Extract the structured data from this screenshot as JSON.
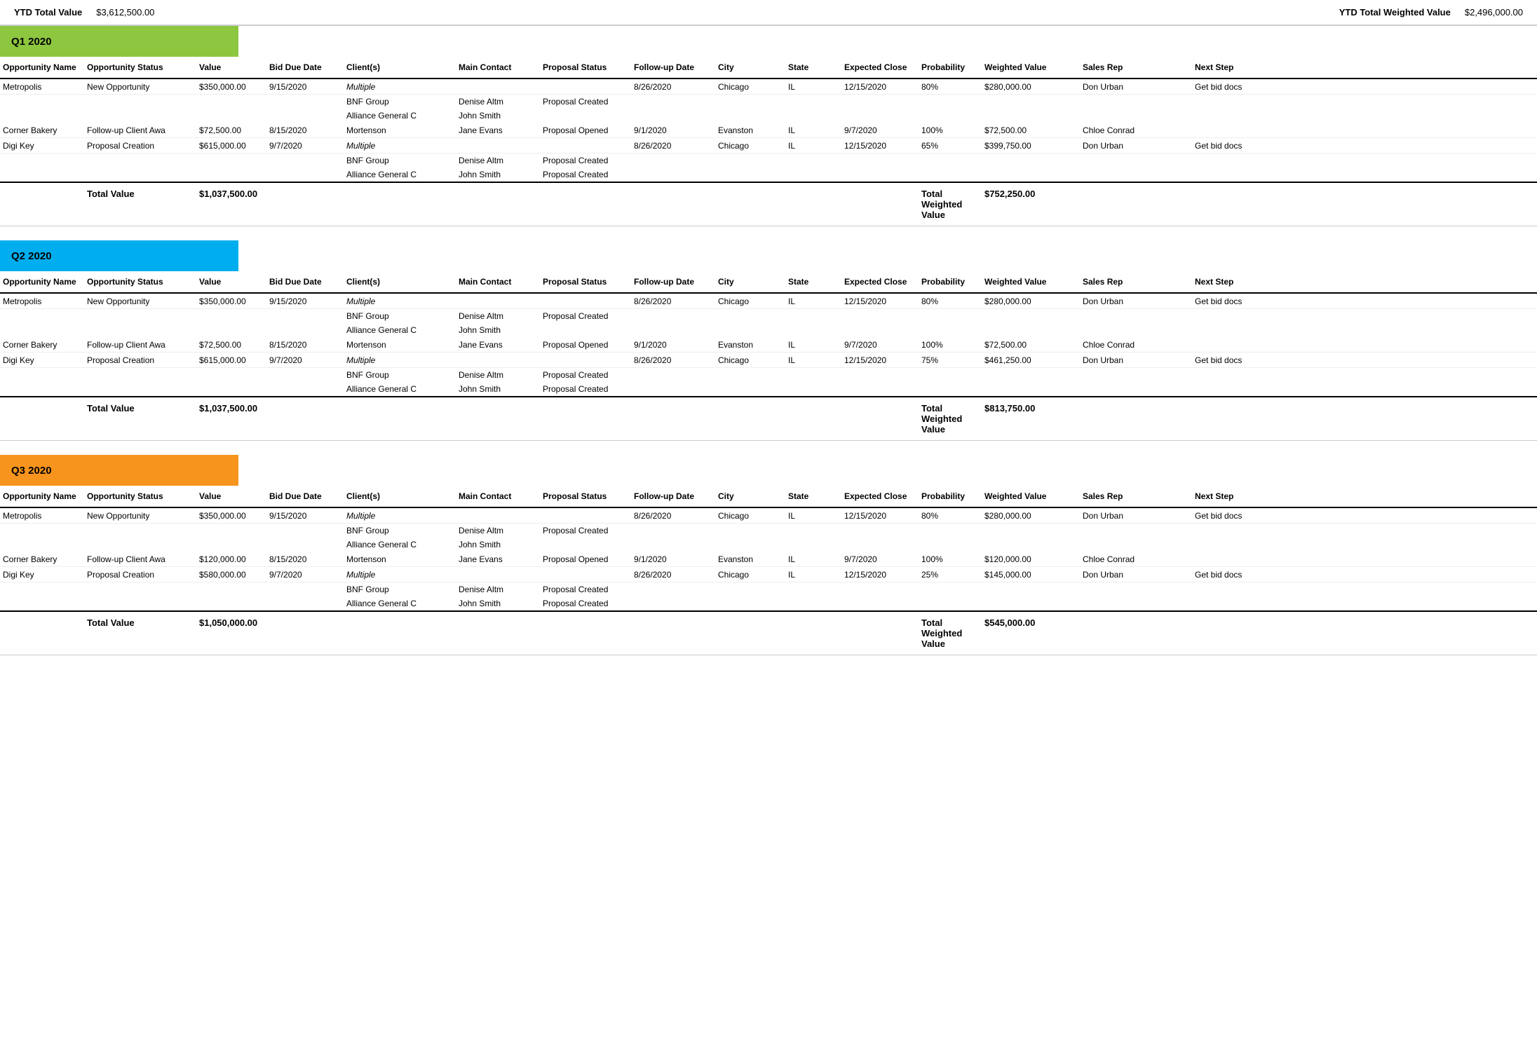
{
  "header": {
    "ytd_total_label": "YTD Total Value",
    "ytd_total_value": "$3,612,500.00",
    "ytd_weighted_label": "YTD Total Weighted Value",
    "ytd_weighted_value": "$2,496,000.00"
  },
  "columns": [
    "Opportunity Name",
    "Opportunity Status",
    "Value",
    "Bid Due Date",
    "Client(s)",
    "Main Contact",
    "Proposal Status",
    "Follow-up Date",
    "City",
    "State",
    "Expected Close",
    "Probability",
    "Weighted Value",
    "Sales Rep",
    "Next Step"
  ],
  "quarters": [
    {
      "label": "Q1 2020",
      "color_class": "q1-header",
      "total_value_label": "Total Value",
      "total_value": "$1,037,500.00",
      "total_weighted_label": "Total Weighted Value",
      "total_weighted": "$752,250.00",
      "opportunities": [
        {
          "name": "Metropolis",
          "status": "New Opportunity",
          "value": "$350,000.00",
          "bid_due": "9/15/2020",
          "clients": [
            "Multiple",
            "BNF Group",
            "Alliance General C"
          ],
          "contacts": [
            "",
            "Denise Altm",
            "John Smith"
          ],
          "proposal_status": [
            "",
            "Proposal Created",
            ""
          ],
          "followup": "8/26/2020",
          "city": "Chicago",
          "state": "IL",
          "expected_close": "12/15/2020",
          "probability": "80%",
          "weighted_value": "$280,000.00",
          "sales_rep": "Don Urban",
          "next_step": "Get bid docs"
        },
        {
          "name": "Corner Bakery",
          "status": "Follow-up Client Awa",
          "value": "$72,500.00",
          "bid_due": "8/15/2020",
          "clients": [
            "Mortenson"
          ],
          "contacts": [
            "Jane Evans"
          ],
          "proposal_status": [
            "Proposal Opened"
          ],
          "followup": "9/1/2020",
          "city": "Evanston",
          "state": "IL",
          "expected_close": "9/7/2020",
          "probability": "100%",
          "weighted_value": "$72,500.00",
          "sales_rep": "Chloe Conrad",
          "next_step": ""
        },
        {
          "name": "Digi Key",
          "status": "Proposal Creation",
          "value": "$615,000.00",
          "bid_due": "9/7/2020",
          "clients": [
            "Multiple",
            "BNF Group",
            "Alliance General C"
          ],
          "contacts": [
            "",
            "Denise Altm",
            "John Smith"
          ],
          "proposal_status": [
            "",
            "Proposal Created",
            "Proposal Created"
          ],
          "followup": "8/26/2020",
          "city": "Chicago",
          "state": "IL",
          "expected_close": "12/15/2020",
          "probability": "65%",
          "weighted_value": "$399,750.00",
          "sales_rep": "Don Urban",
          "next_step": "Get bid docs"
        }
      ]
    },
    {
      "label": "Q2 2020",
      "color_class": "q2-header",
      "total_value_label": "Total Value",
      "total_value": "$1,037,500.00",
      "total_weighted_label": "Total Weighted Value",
      "total_weighted": "$813,750.00",
      "opportunities": [
        {
          "name": "Metropolis",
          "status": "New Opportunity",
          "value": "$350,000.00",
          "bid_due": "9/15/2020",
          "clients": [
            "Multiple",
            "BNF Group",
            "Alliance General C"
          ],
          "contacts": [
            "",
            "Denise Altm",
            "John Smith"
          ],
          "proposal_status": [
            "",
            "Proposal Created",
            ""
          ],
          "followup": "8/26/2020",
          "city": "Chicago",
          "state": "IL",
          "expected_close": "12/15/2020",
          "probability": "80%",
          "weighted_value": "$280,000.00",
          "sales_rep": "Don Urban",
          "next_step": "Get bid docs"
        },
        {
          "name": "Corner Bakery",
          "status": "Follow-up Client Awa",
          "value": "$72,500.00",
          "bid_due": "8/15/2020",
          "clients": [
            "Mortenson"
          ],
          "contacts": [
            "Jane Evans"
          ],
          "proposal_status": [
            "Proposal Opened"
          ],
          "followup": "9/1/2020",
          "city": "Evanston",
          "state": "IL",
          "expected_close": "9/7/2020",
          "probability": "100%",
          "weighted_value": "$72,500.00",
          "sales_rep": "Chloe Conrad",
          "next_step": ""
        },
        {
          "name": "Digi Key",
          "status": "Proposal Creation",
          "value": "$615,000.00",
          "bid_due": "9/7/2020",
          "clients": [
            "Multiple",
            "BNF Group",
            "Alliance General C"
          ],
          "contacts": [
            "",
            "Denise Altm",
            "John Smith"
          ],
          "proposal_status": [
            "",
            "Proposal Created",
            "Proposal Created"
          ],
          "followup": "8/26/2020",
          "city": "Chicago",
          "state": "IL",
          "expected_close": "12/15/2020",
          "probability": "75%",
          "weighted_value": "$461,250.00",
          "sales_rep": "Don Urban",
          "next_step": "Get bid docs"
        }
      ]
    },
    {
      "label": "Q3 2020",
      "color_class": "q3-header",
      "total_value_label": "Total Value",
      "total_value": "$1,050,000.00",
      "total_weighted_label": "Total Weighted Value",
      "total_weighted": "$545,000.00",
      "opportunities": [
        {
          "name": "Metropolis",
          "status": "New Opportunity",
          "value": "$350,000.00",
          "bid_due": "9/15/2020",
          "clients": [
            "Multiple",
            "BNF Group",
            "Alliance General C"
          ],
          "contacts": [
            "",
            "Denise Altm",
            "John Smith"
          ],
          "proposal_status": [
            "",
            "Proposal Created",
            ""
          ],
          "followup": "8/26/2020",
          "city": "Chicago",
          "state": "IL",
          "expected_close": "12/15/2020",
          "probability": "80%",
          "weighted_value": "$280,000.00",
          "sales_rep": "Don Urban",
          "next_step": "Get bid docs"
        },
        {
          "name": "Corner Bakery",
          "status": "Follow-up Client Awa",
          "value": "$120,000.00",
          "bid_due": "8/15/2020",
          "clients": [
            "Mortenson"
          ],
          "contacts": [
            "Jane Evans"
          ],
          "proposal_status": [
            "Proposal Opened"
          ],
          "followup": "9/1/2020",
          "city": "Evanston",
          "state": "IL",
          "expected_close": "9/7/2020",
          "probability": "100%",
          "weighted_value": "$120,000.00",
          "sales_rep": "Chloe Conrad",
          "next_step": ""
        },
        {
          "name": "Digi Key",
          "status": "Proposal Creation",
          "value": "$580,000.00",
          "bid_due": "9/7/2020",
          "clients": [
            "Multiple",
            "BNF Group",
            "Alliance General C"
          ],
          "contacts": [
            "",
            "Denise Altm",
            "John Smith"
          ],
          "proposal_status": [
            "",
            "Proposal Created",
            "Proposal Created"
          ],
          "followup": "8/26/2020",
          "city": "Chicago",
          "state": "IL",
          "expected_close": "12/15/2020",
          "probability": "25%",
          "weighted_value": "$145,000.00",
          "sales_rep": "Don Urban",
          "next_step": "Get bid docs"
        }
      ]
    }
  ]
}
